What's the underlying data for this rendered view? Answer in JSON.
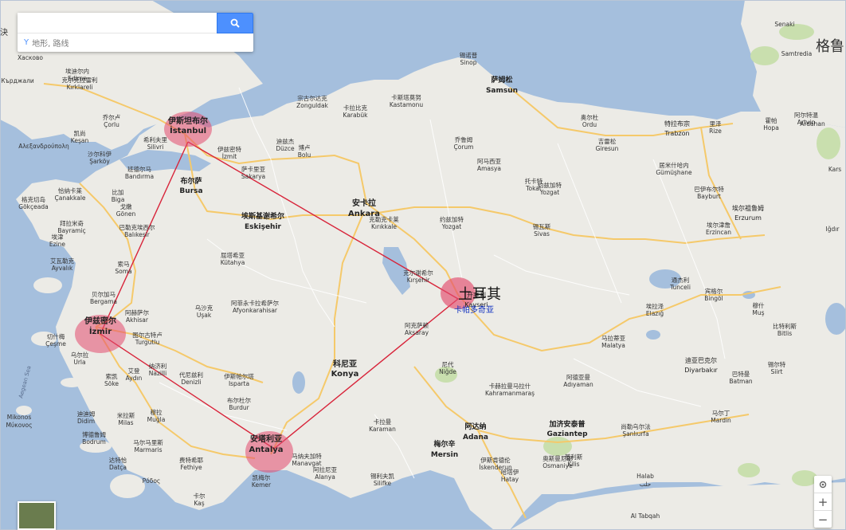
{
  "search": {
    "placeholder": "",
    "suggest_text": "地形, 路线",
    "button_icon": "search-icon"
  },
  "left_edge_label": "決",
  "right_edge_label": "格鲁",
  "zoom": {
    "plus": "+",
    "minus": "−"
  },
  "colors": {
    "sea": "#a5bfdd",
    "land": "#ecebe6",
    "highway": "#f5c96a",
    "route": "#d8243a",
    "highlight": "#e44b6d",
    "park": "#c9dfae"
  },
  "country": {
    "name": "土耳其",
    "subtitle": "卡帕多奇亚"
  },
  "highlighted_cities": [
    {
      "id": "istanbul",
      "cn": "伊斯坦布尔",
      "en": "İstanbul"
    },
    {
      "id": "izmir",
      "cn": "伊兹密尔",
      "en": "İzmir"
    },
    {
      "id": "antalya",
      "cn": "安塔利亚",
      "en": "Antalya"
    },
    {
      "id": "cappadocia",
      "cn": "",
      "en": ""
    }
  ],
  "route_order": [
    "istanbul",
    "cappadocia",
    "antalya",
    "izmir",
    "istanbul"
  ],
  "major_cities": [
    {
      "cn": "安卡拉",
      "en": "Ankara"
    },
    {
      "cn": "布尔萨",
      "en": "Bursa"
    },
    {
      "cn": "科尼亚",
      "en": "Konya"
    },
    {
      "cn": "阿达纳",
      "en": "Adana"
    },
    {
      "cn": "梅尔辛",
      "en": "Mersin"
    },
    {
      "cn": "加济安泰普",
      "en": "Gaziantep"
    },
    {
      "cn": "萨姆松",
      "en": "Samsun"
    },
    {
      "cn": "埃斯基谢希尔",
      "en": "Eskişehir"
    },
    {
      "cn": "开塞利",
      "en": "Kayseri"
    },
    {
      "cn": "特拉布宗",
      "en": "Trabzon"
    },
    {
      "cn": "埃尔祖鲁姆",
      "en": "Erzurum"
    },
    {
      "cn": "迪亚巴克尔",
      "en": "Diyarbakır"
    }
  ],
  "towns": [
    {
      "cn": "埃迪尔内",
      "en": "Edirne"
    },
    {
      "cn": "克尔克拉雷利",
      "en": "Kırklareli"
    },
    {
      "cn": "乔尔卢",
      "en": "Çorlu"
    },
    {
      "cn": "凯尚",
      "en": "Keşan"
    },
    {
      "cn": "希利夫里",
      "en": "Silivri"
    },
    {
      "cn": "沙尔科伊",
      "en": "Şarköy"
    },
    {
      "cn": "班德尔马",
      "en": "Bandırma"
    },
    {
      "cn": "恰纳卡莱",
      "en": "Çanakkale"
    },
    {
      "cn": "格克切岛",
      "en": "Gökçeada"
    },
    {
      "cn": "比加",
      "en": "Biga"
    },
    {
      "cn": "戈嫩",
      "en": "Gönen"
    },
    {
      "cn": "巴勒克埃西尔",
      "en": "Balıkesir"
    },
    {
      "cn": "拜拉米奇",
      "en": "Bayramiç"
    },
    {
      "cn": "埃津",
      "en": "Ezine"
    },
    {
      "cn": "艾瓦勒克",
      "en": "Ayvalık"
    },
    {
      "cn": "索马",
      "en": "Soma"
    },
    {
      "cn": "贝尔加马",
      "en": "Bergama"
    },
    {
      "cn": "阿赫萨尔",
      "en": "Akhisar"
    },
    {
      "cn": "图尔古特卢",
      "en": "Turgutlu"
    },
    {
      "cn": "切什梅",
      "en": "Çeşme"
    },
    {
      "cn": "乌尔拉",
      "en": "Urla"
    },
    {
      "cn": "艾登",
      "en": "Aydın"
    },
    {
      "cn": "索凯",
      "en": "Söke"
    },
    {
      "cn": "纳济利",
      "en": "Nazilli"
    },
    {
      "cn": "代尼兹利",
      "en": "Denizli"
    },
    {
      "cn": "迪迪姆",
      "en": "Didim"
    },
    {
      "cn": "博德鲁姆",
      "en": "Bodrum"
    },
    {
      "cn": "米拉斯",
      "en": "Milas"
    },
    {
      "cn": "穆拉",
      "en": "Muğla"
    },
    {
      "cn": "马尔马里斯",
      "en": "Marmaris"
    },
    {
      "cn": "费特希耶",
      "en": "Fethiye"
    },
    {
      "cn": "达特恰",
      "en": "Datça"
    },
    {
      "cn": "伊兹密特",
      "en": "İzmit"
    },
    {
      "cn": "萨卡里亚",
      "en": "Sakarya"
    },
    {
      "cn": "迪兹杰",
      "en": "Düzce"
    },
    {
      "cn": "博卢",
      "en": "Bolu"
    },
    {
      "cn": "宗古尔达克",
      "en": "Zonguldak"
    },
    {
      "cn": "卡拉比克",
      "en": "Karabük"
    },
    {
      "cn": "卡斯塔莫努",
      "en": "Kastamonu"
    },
    {
      "cn": "锡诺普",
      "en": "Sinop"
    },
    {
      "cn": "乔鲁姆",
      "en": "Çorum"
    },
    {
      "cn": "阿马西亚",
      "en": "Amasya"
    },
    {
      "cn": "托卡特",
      "en": "Tokat"
    },
    {
      "cn": "锡瓦斯",
      "en": "Sivas"
    },
    {
      "cn": "约兹加特",
      "en": "Yozgat"
    },
    {
      "cn": "克尔谢希尔",
      "en": "Kırşehir"
    },
    {
      "cn": "克勒克卡莱",
      "en": "Kırıkkale"
    },
    {
      "cn": "阿克萨赖",
      "en": "Aksaray"
    },
    {
      "cn": "尼代",
      "en": "Niğde"
    },
    {
      "cn": "卡拉曼",
      "en": "Karaman"
    },
    {
      "cn": "伊斯帕尔塔",
      "en": "Isparta"
    },
    {
      "cn": "布尔杜尔",
      "en": "Burdur"
    },
    {
      "cn": "阿菲永卡拉希萨尔",
      "en": "Afyonkarahisar"
    },
    {
      "cn": "屈塔希亚",
      "en": "Kütahya"
    },
    {
      "cn": "乌沙克",
      "en": "Uşak"
    },
    {
      "cn": "阿拉尼亚",
      "en": "Alanya"
    },
    {
      "cn": "马纳夫加特",
      "en": "Manavgat"
    },
    {
      "cn": "凯梅尔",
      "en": "Kemer"
    },
    {
      "cn": "卡尔",
      "en": "Kaş"
    },
    {
      "cn": "锡利夫凯",
      "en": "Silifke"
    },
    {
      "cn": "奥斯曼尼耶",
      "en": "Osmaniye"
    },
    {
      "cn": "卡赫拉曼马拉什",
      "en": "Kahramanmaraş"
    },
    {
      "cn": "阿德亚曼",
      "en": "Adıyaman"
    },
    {
      "cn": "马拉蒂亚",
      "en": "Malatya"
    },
    {
      "cn": "埃拉泽",
      "en": "Elazığ"
    },
    {
      "cn": "宾格尔",
      "en": "Bingöl"
    },
    {
      "cn": "穆什",
      "en": "Muş"
    },
    {
      "cn": "巴特曼",
      "en": "Batman"
    },
    {
      "cn": "马尔丁",
      "en": "Mardin"
    },
    {
      "cn": "尚勒乌尔法",
      "en": "Şanlıurfa"
    },
    {
      "cn": "锡尔特",
      "en": "Siirt"
    },
    {
      "cn": "比特利斯",
      "en": "Bitlis"
    },
    {
      "cn": "埃尔津詹",
      "en": "Erzincan"
    },
    {
      "cn": "通杰利",
      "en": "Tunceli"
    },
    {
      "cn": "巴伊布尔特",
      "en": "Bayburt"
    },
    {
      "cn": "居米什哈内",
      "en": "Gümüşhane"
    },
    {
      "cn": "吉雷松",
      "en": "Giresun"
    },
    {
      "cn": "奥尔杜",
      "en": "Ordu"
    },
    {
      "cn": "里泽",
      "en": "Rize"
    },
    {
      "cn": "霍帕",
      "en": "Hopa"
    },
    {
      "cn": "阿尔特温",
      "en": "Artvin"
    },
    {
      "cn": "约兹加特",
      "en": "Yozgat"
    },
    {
      "cn": "哈塔伊",
      "en": "Hatay"
    },
    {
      "cn": "伊斯肯德伦",
      "en": "İskenderun"
    },
    {
      "cn": "基利斯",
      "en": "Kilis"
    }
  ],
  "sea_labels": [
    {
      "text": "Aegean Sea"
    }
  ],
  "foreign_labels": [
    {
      "text": "Mikonos"
    },
    {
      "text": "Μύκονος"
    },
    {
      "text": "Ρόδος"
    },
    {
      "text": "Αλεξανδρούπολη"
    },
    {
      "text": "Кърджали"
    },
    {
      "text": "Хасково"
    },
    {
      "text": "Senaki"
    },
    {
      "text": "Samtredia"
    },
    {
      "text": "Ardahan"
    },
    {
      "text": "Kars"
    },
    {
      "text": "Iğdır"
    },
    {
      "text": "Halab"
    },
    {
      "text": "حلب"
    },
    {
      "text": "Al Tabqah"
    }
  ]
}
